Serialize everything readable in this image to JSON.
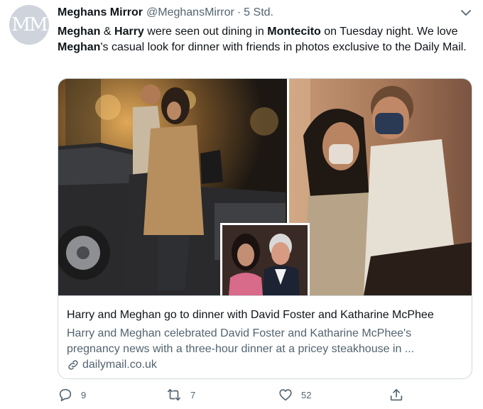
{
  "tweet": {
    "avatar_text": "MM",
    "author_name": "Meghans Mirror",
    "author_handle": "@MeghansMirror",
    "separator": "·",
    "time": "5 Std.",
    "text_parts": [
      {
        "t": "Meghan",
        "b": true
      },
      {
        "t": " & ",
        "b": false
      },
      {
        "t": "Harry",
        "b": true
      },
      {
        "t": " were seen out dining in ",
        "b": false
      },
      {
        "t": "Montecito",
        "b": true
      },
      {
        "t": " on Tuesday night. We love ",
        "b": false
      },
      {
        "t": "Meghan",
        "b": true
      },
      {
        "t": "'s casual look for dinner with friends in photos exclusive to the Daily Mail.",
        "b": false
      }
    ]
  },
  "card": {
    "title": "Harry and Meghan go to dinner with David Foster and Katharine McPhee",
    "description": "Harry and Meghan celebrated David Foster and Katharine McPhee's pregnancy news with a three-hour dinner at a pricey steakhouse in ...",
    "link": "dailymail.co.uk"
  },
  "actions": {
    "reply_count": "9",
    "retweet_count": "7",
    "like_count": "52"
  },
  "icons": {
    "caret": "chevron-down-icon",
    "reply": "reply-icon",
    "retweet": "retweet-icon",
    "like": "heart-icon",
    "share": "share-icon",
    "link": "link-icon"
  },
  "colors": {
    "text": "#0f1419",
    "secondary": "#536471",
    "border": "#cfd9de"
  }
}
